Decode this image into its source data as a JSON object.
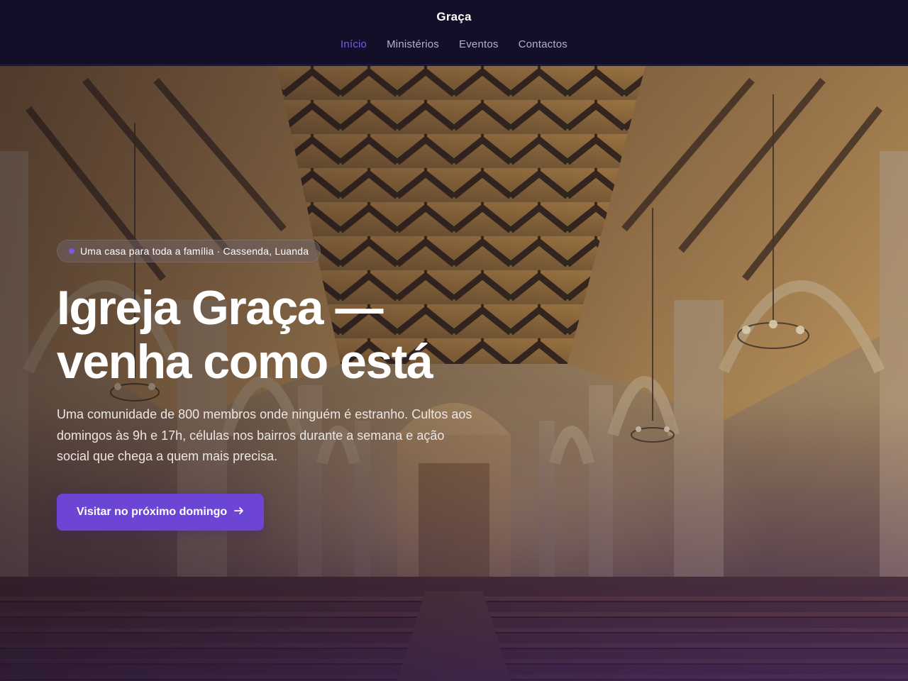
{
  "header": {
    "brand": "Graça",
    "nav": [
      {
        "label": "Início",
        "active": true
      },
      {
        "label": "Ministérios",
        "active": false
      },
      {
        "label": "Eventos",
        "active": false
      },
      {
        "label": "Contactos",
        "active": false
      }
    ]
  },
  "hero": {
    "badge": "Uma casa para toda a família · Cassenda, Luanda",
    "headline_line1": "Igreja Graça —",
    "headline_line2": "venha como está",
    "description": "Uma comunidade de 800 membros onde ninguém é estranho. Cultos aos domingos às 9h e 17h, células nos bairros durante a semana e ação social que chega a quem mais precisa.",
    "cta_label": "Visitar no próximo domingo",
    "cta_icon": "arrow-right-icon",
    "background": "church-nave-interior-photo"
  },
  "colors": {
    "header_bg": "#130f29",
    "accent": "#7b59e6",
    "cta_bg": "#6d45d4",
    "nav_text": "#b6b0cc"
  }
}
